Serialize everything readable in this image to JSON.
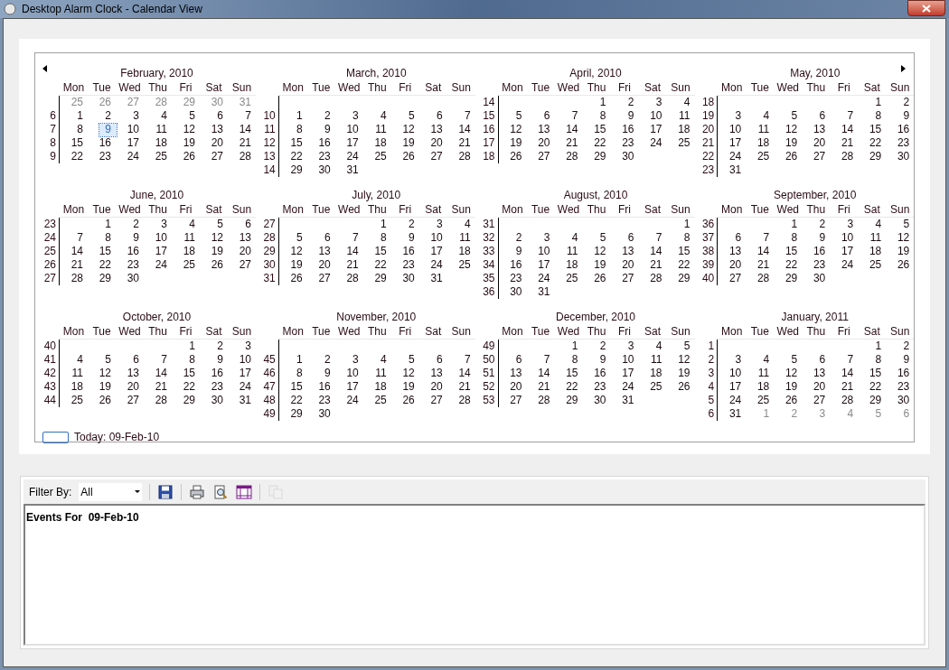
{
  "window": {
    "title": "Desktop Alarm Clock - Calendar View"
  },
  "calendar": {
    "months": [
      {
        "title": "February, 2010",
        "weekdays": [
          "Mon",
          "Tue",
          "Wed",
          "Thu",
          "Fri",
          "Sat",
          "Sun"
        ],
        "weeks": [
          {
            "lead": [
              "25",
              "26",
              "27",
              "28",
              "29",
              "30",
              "31"
            ]
          },
          {
            "week": "6",
            "days": [
              "1",
              "2",
              "3",
              "4",
              "5",
              "6",
              "7"
            ]
          },
          {
            "week": "7",
            "days": [
              "8"
            ],
            "today": "9",
            "after": [
              "10",
              "11",
              "12",
              "13",
              "14"
            ]
          },
          {
            "week": "8",
            "days": [
              "15",
              "16",
              "17",
              "18",
              "19",
              "20",
              "21"
            ]
          },
          {
            "week": "9",
            "days": [
              "22",
              "23",
              "24",
              "25",
              "26",
              "27",
              "28"
            ]
          }
        ]
      },
      {
        "title": "March, 2010",
        "weekdays": [
          "Mon",
          "Tue",
          "Wed",
          "Thu",
          "Fri",
          "Sat",
          "Sun"
        ],
        "weeks": [
          {
            "week": "10",
            "days": [
              "1",
              "2",
              "3",
              "4",
              "5",
              "6",
              "7"
            ]
          },
          {
            "week": "11",
            "days": [
              "8",
              "9",
              "10",
              "11",
              "12",
              "13",
              "14"
            ]
          },
          {
            "week": "12",
            "days": [
              "15",
              "16",
              "17",
              "18",
              "19",
              "20",
              "21"
            ]
          },
          {
            "week": "13",
            "days": [
              "22",
              "23",
              "24",
              "25",
              "26",
              "27",
              "28"
            ]
          },
          {
            "week": "14",
            "days": [
              "29",
              "30",
              "31"
            ]
          }
        ]
      },
      {
        "title": "April, 2010",
        "weekdays": [
          "Mon",
          "Tue",
          "Wed",
          "Thu",
          "Fri",
          "Sat",
          "Sun"
        ],
        "weeks": [
          {
            "week": "14",
            "days": [
              "1",
              "2",
              "3",
              "4"
            ]
          },
          {
            "week": "15",
            "days": [
              "5",
              "6",
              "7",
              "8",
              "9",
              "10",
              "11"
            ]
          },
          {
            "week": "16",
            "days": [
              "12",
              "13",
              "14",
              "15",
              "16",
              "17",
              "18"
            ]
          },
          {
            "week": "17",
            "days": [
              "19",
              "20",
              "21",
              "22",
              "23",
              "24",
              "25"
            ]
          },
          {
            "week": "18",
            "days": [
              "26",
              "27",
              "28",
              "29",
              "30"
            ]
          }
        ]
      },
      {
        "title": "May, 2010",
        "weekdays": [
          "Mon",
          "Tue",
          "Wed",
          "Thu",
          "Fri",
          "Sat",
          "Sun"
        ],
        "weeks": [
          {
            "week": "18",
            "days": [
              "1",
              "2"
            ]
          },
          {
            "week": "19",
            "days": [
              "3",
              "4",
              "5",
              "6",
              "7",
              "8",
              "9"
            ]
          },
          {
            "week": "20",
            "days": [
              "10",
              "11",
              "12",
              "13",
              "14",
              "15",
              "16"
            ]
          },
          {
            "week": "21",
            "days": [
              "17",
              "18",
              "19",
              "20",
              "21",
              "22",
              "23"
            ]
          },
          {
            "week": "22",
            "days": [
              "24",
              "25",
              "26",
              "27",
              "28",
              "29",
              "30"
            ]
          },
          {
            "week": "23",
            "days": [
              "31"
            ]
          }
        ]
      },
      {
        "title": "June, 2010",
        "weekdays": [
          "Mon",
          "Tue",
          "Wed",
          "Thu",
          "Fri",
          "Sat",
          "Sun"
        ],
        "weeks": [
          {
            "week": "23",
            "days": [
              "1",
              "2",
              "3",
              "4",
              "5",
              "6"
            ]
          },
          {
            "week": "24",
            "days": [
              "7",
              "8",
              "9",
              "10",
              "11",
              "12",
              "13"
            ]
          },
          {
            "week": "25",
            "days": [
              "14",
              "15",
              "16",
              "17",
              "18",
              "19",
              "20"
            ]
          },
          {
            "week": "26",
            "days": [
              "21",
              "22",
              "23",
              "24",
              "25",
              "26",
              "27"
            ]
          },
          {
            "week": "27",
            "days": [
              "28",
              "29",
              "30"
            ]
          }
        ]
      },
      {
        "title": "July, 2010",
        "weekdays": [
          "Mon",
          "Tue",
          "Wed",
          "Thu",
          "Fri",
          "Sat",
          "Sun"
        ],
        "weeks": [
          {
            "week": "27",
            "days": [
              "1",
              "2",
              "3",
              "4"
            ]
          },
          {
            "week": "28",
            "days": [
              "5",
              "6",
              "7",
              "8",
              "9",
              "10",
              "11"
            ]
          },
          {
            "week": "29",
            "days": [
              "12",
              "13",
              "14",
              "15",
              "16",
              "17",
              "18"
            ]
          },
          {
            "week": "30",
            "days": [
              "19",
              "20",
              "21",
              "22",
              "23",
              "24",
              "25"
            ]
          },
          {
            "week": "31",
            "days": [
              "26",
              "27",
              "28",
              "29",
              "30",
              "31"
            ]
          }
        ]
      },
      {
        "title": "August, 2010",
        "weekdays": [
          "Mon",
          "Tue",
          "Wed",
          "Thu",
          "Fri",
          "Sat",
          "Sun"
        ],
        "weeks": [
          {
            "week": "31",
            "days": [
              "1"
            ]
          },
          {
            "week": "32",
            "days": [
              "2",
              "3",
              "4",
              "5",
              "6",
              "7",
              "8"
            ]
          },
          {
            "week": "33",
            "days": [
              "9",
              "10",
              "11",
              "12",
              "13",
              "14",
              "15"
            ]
          },
          {
            "week": "34",
            "days": [
              "16",
              "17",
              "18",
              "19",
              "20",
              "21",
              "22"
            ]
          },
          {
            "week": "35",
            "days": [
              "23",
              "24",
              "25",
              "26",
              "27",
              "28",
              "29"
            ]
          },
          {
            "week": "36",
            "days": [
              "30",
              "31"
            ]
          }
        ]
      },
      {
        "title": "September, 2010",
        "weekdays": [
          "Mon",
          "Tue",
          "Wed",
          "Thu",
          "Fri",
          "Sat",
          "Sun"
        ],
        "weeks": [
          {
            "week": "36",
            "days": [
              "1",
              "2",
              "3",
              "4",
              "5"
            ]
          },
          {
            "week": "37",
            "days": [
              "6",
              "7",
              "8",
              "9",
              "10",
              "11",
              "12"
            ]
          },
          {
            "week": "38",
            "days": [
              "13",
              "14",
              "15",
              "16",
              "17",
              "18",
              "19"
            ]
          },
          {
            "week": "39",
            "days": [
              "20",
              "21",
              "22",
              "23",
              "24",
              "25",
              "26"
            ]
          },
          {
            "week": "40",
            "days": [
              "27",
              "28",
              "29",
              "30"
            ]
          }
        ]
      },
      {
        "title": "October, 2010",
        "weekdays": [
          "Mon",
          "Tue",
          "Wed",
          "Thu",
          "Fri",
          "Sat",
          "Sun"
        ],
        "weeks": [
          {
            "week": "40",
            "days": [
              "1",
              "2",
              "3"
            ]
          },
          {
            "week": "41",
            "days": [
              "4",
              "5",
              "6",
              "7",
              "8",
              "9",
              "10"
            ]
          },
          {
            "week": "42",
            "days": [
              "11",
              "12",
              "13",
              "14",
              "15",
              "16",
              "17"
            ]
          },
          {
            "week": "43",
            "days": [
              "18",
              "19",
              "20",
              "21",
              "22",
              "23",
              "24"
            ]
          },
          {
            "week": "44",
            "days": [
              "25",
              "26",
              "27",
              "28",
              "29",
              "30",
              "31"
            ]
          }
        ]
      },
      {
        "title": "November, 2010",
        "weekdays": [
          "Mon",
          "Tue",
          "Wed",
          "Thu",
          "Fri",
          "Sat",
          "Sun"
        ],
        "weeks": [
          {
            "week": "45",
            "days": [
              "1",
              "2",
              "3",
              "4",
              "5",
              "6",
              "7"
            ]
          },
          {
            "week": "46",
            "days": [
              "8",
              "9",
              "10",
              "11",
              "12",
              "13",
              "14"
            ]
          },
          {
            "week": "47",
            "days": [
              "15",
              "16",
              "17",
              "18",
              "19",
              "20",
              "21"
            ]
          },
          {
            "week": "48",
            "days": [
              "22",
              "23",
              "24",
              "25",
              "26",
              "27",
              "28"
            ]
          },
          {
            "week": "49",
            "days": [
              "29",
              "30"
            ]
          }
        ]
      },
      {
        "title": "December, 2010",
        "weekdays": [
          "Mon",
          "Tue",
          "Wed",
          "Thu",
          "Fri",
          "Sat",
          "Sun"
        ],
        "weeks": [
          {
            "week": "49",
            "days": [
              "1",
              "2",
              "3",
              "4",
              "5"
            ]
          },
          {
            "week": "50",
            "days": [
              "6",
              "7",
              "8",
              "9",
              "10",
              "11",
              "12"
            ]
          },
          {
            "week": "51",
            "days": [
              "13",
              "14",
              "15",
              "16",
              "17",
              "18",
              "19"
            ]
          },
          {
            "week": "52",
            "days": [
              "20",
              "21",
              "22",
              "23",
              "24",
              "25",
              "26"
            ]
          },
          {
            "week": "53",
            "days": [
              "27",
              "28",
              "29",
              "30",
              "31"
            ]
          }
        ]
      },
      {
        "title": "January, 2011",
        "weekdays": [
          "Mon",
          "Tue",
          "Wed",
          "Thu",
          "Fri",
          "Sat",
          "Sun"
        ],
        "weeks": [
          {
            "week": "1",
            "days": [
              "1",
              "2"
            ]
          },
          {
            "week": "2",
            "days": [
              "3",
              "4",
              "5",
              "6",
              "7",
              "8",
              "9"
            ]
          },
          {
            "week": "3",
            "days": [
              "10",
              "11",
              "12",
              "13",
              "14",
              "15",
              "16"
            ]
          },
          {
            "week": "4",
            "days": [
              "17",
              "18",
              "19",
              "20",
              "21",
              "22",
              "23"
            ]
          },
          {
            "week": "5",
            "days": [
              "24",
              "25",
              "26",
              "27",
              "28",
              "29",
              "30"
            ]
          },
          {
            "week": "6",
            "days": [
              "31"
            ],
            "trail": [
              "1",
              "2",
              "3",
              "4",
              "5",
              "6"
            ]
          }
        ]
      }
    ],
    "today_label": "Today: 09-Feb-10"
  },
  "toolbar": {
    "filter_label": "Filter By:",
    "filter_value": "All",
    "buttons": [
      {
        "kind": "save",
        "disabled": false
      },
      {
        "kind": "print",
        "disabled": false
      },
      {
        "kind": "preview",
        "disabled": false
      },
      {
        "kind": "calendar",
        "disabled": false
      },
      {
        "kind": "copy",
        "disabled": true
      }
    ]
  },
  "events": {
    "heading": "Events For  09-Feb-10"
  }
}
